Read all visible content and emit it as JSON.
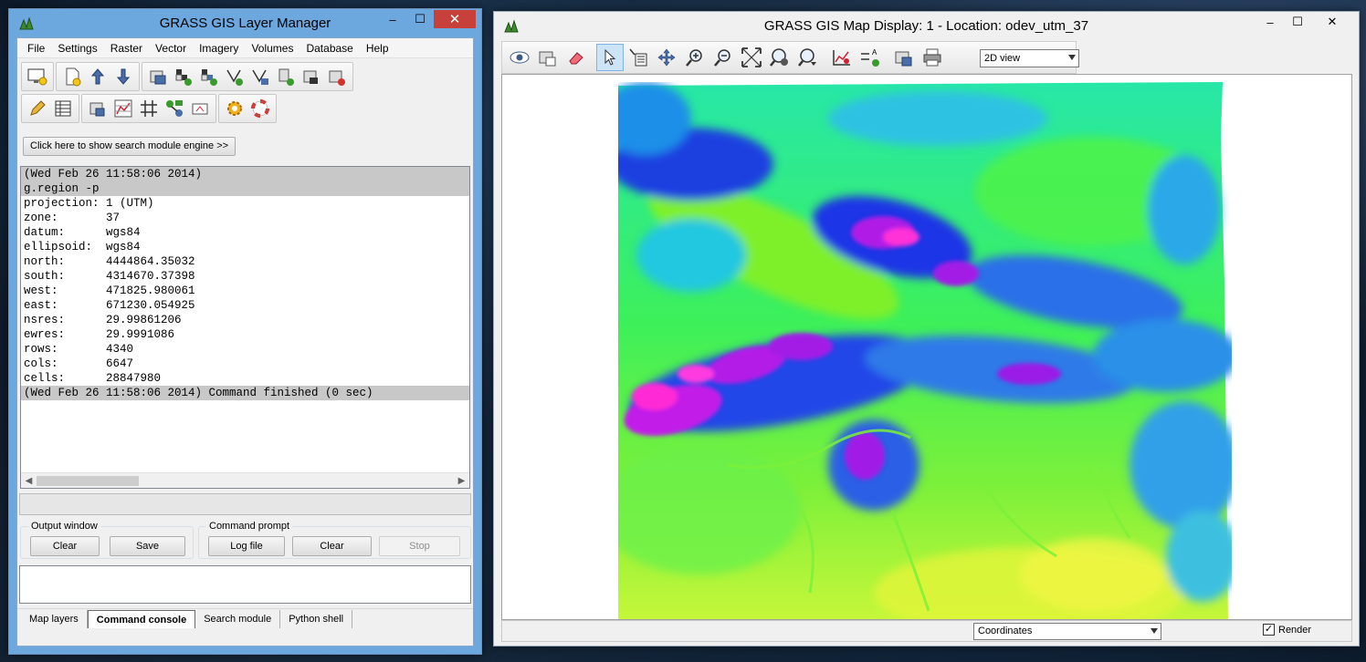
{
  "layer_manager": {
    "title": "GRASS GIS Layer Manager",
    "menu": [
      "File",
      "Settings",
      "Raster",
      "Vector",
      "Imagery",
      "Volumes",
      "Database",
      "Help"
    ],
    "search_engine_button": "Click here to show search module engine >>",
    "console_lines": [
      {
        "text": "(Wed Feb 26 11:58:06 2014)",
        "highlight": true
      },
      {
        "text": "g.region -p",
        "highlight": true
      },
      {
        "text": "projection: 1 (UTM)",
        "highlight": false
      },
      {
        "text": "zone:       37",
        "highlight": false
      },
      {
        "text": "datum:      wgs84",
        "highlight": false
      },
      {
        "text": "ellipsoid:  wgs84",
        "highlight": false
      },
      {
        "text": "north:      4444864.35032",
        "highlight": false
      },
      {
        "text": "south:      4314670.37398",
        "highlight": false
      },
      {
        "text": "west:       471825.980061",
        "highlight": false
      },
      {
        "text": "east:       671230.054925",
        "highlight": false
      },
      {
        "text": "nsres:      29.99861206",
        "highlight": false
      },
      {
        "text": "ewres:      29.9991086",
        "highlight": false
      },
      {
        "text": "rows:       4340",
        "highlight": false
      },
      {
        "text": "cols:       6647",
        "highlight": false
      },
      {
        "text": "cells:      28847980",
        "highlight": false
      },
      {
        "text": "(Wed Feb 26 11:58:06 2014) Command finished (0 sec)",
        "highlight": true
      }
    ],
    "output_window": {
      "legend": "Output window",
      "clear": "Clear",
      "save": "Save"
    },
    "command_prompt": {
      "legend": "Command prompt",
      "log_file": "Log file",
      "clear": "Clear",
      "stop": "Stop"
    },
    "tabs": [
      {
        "label": "Map layers",
        "selected": false
      },
      {
        "label": "Command console",
        "selected": true
      },
      {
        "label": "Search module",
        "selected": false
      },
      {
        "label": "Python shell",
        "selected": false
      }
    ]
  },
  "map_display": {
    "title": "GRASS GIS Map Display: 1  - Location: odev_utm_37",
    "view_mode": "2D view",
    "status_mode": "Coordinates",
    "render_label": "Render",
    "render_checked": true
  },
  "window_controls": {
    "minimize": "–",
    "maximize": "☐",
    "close": "✕"
  },
  "colors": {
    "titlebar_active": "#6ca8de",
    "console_highlight": "#c8c8c8",
    "close_button": "#c7403a"
  }
}
